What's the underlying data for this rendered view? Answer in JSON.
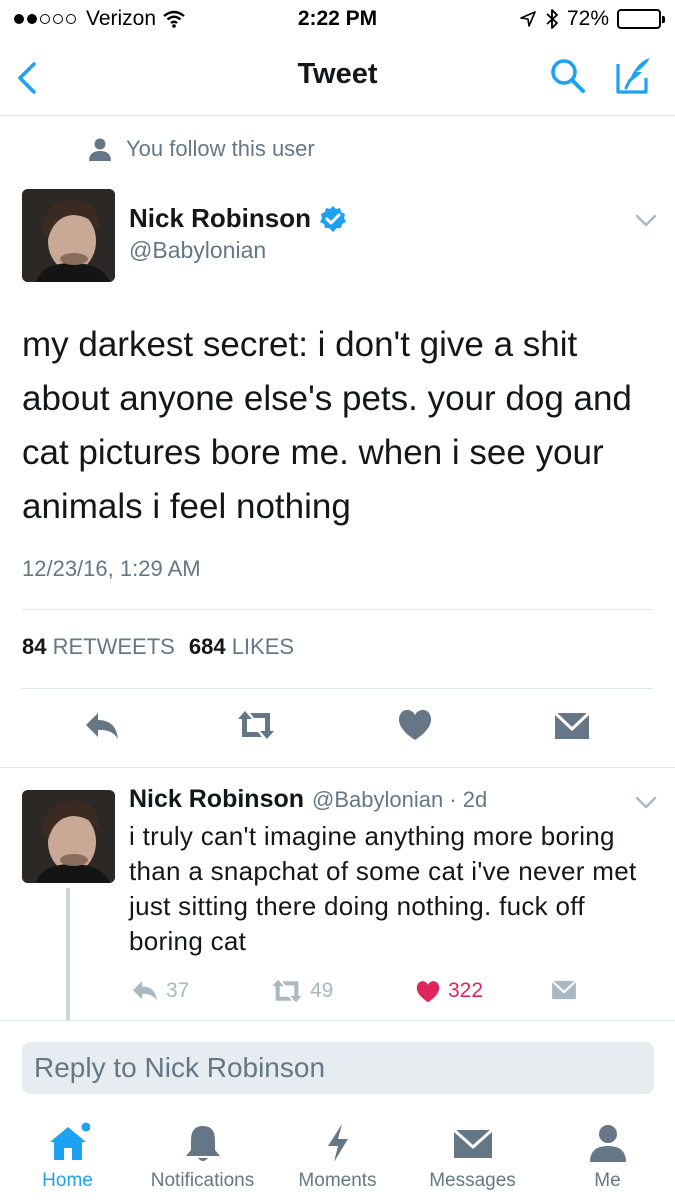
{
  "status_bar": {
    "carrier": "Verizon",
    "time": "2:22 PM",
    "battery": "72%",
    "battery_level": 0.72
  },
  "nav": {
    "title": "Tweet"
  },
  "follow_note": "You follow this user",
  "main_tweet": {
    "author_name": "Nick Robinson",
    "handle": "@Babylonian",
    "verified": true,
    "text": "my darkest secret: i don't give a shit about anyone else's pets. your dog and cat pictures bore me. when i see your animals i feel nothing",
    "timestamp": "12/23/16, 1:29 AM",
    "retweets_count": "84",
    "retweets_label": "RETWEETS",
    "likes_count": "684",
    "likes_label": "LIKES"
  },
  "reply_tweet": {
    "author_name": "Nick Robinson",
    "handle_time": "@Babylonian · 2d",
    "text": "i truly can't imagine anything more boring than a snapchat of some cat i've never met just sitting there doing nothing. fuck off boring cat",
    "replies": "37",
    "retweets": "49",
    "likes": "322"
  },
  "reply_box": {
    "placeholder": "Reply to Nick Robinson"
  },
  "tab_bar": [
    {
      "label": "Home",
      "icon": "home-icon",
      "active": true
    },
    {
      "label": "Notifications",
      "icon": "bell-icon",
      "active": false
    },
    {
      "label": "Moments",
      "icon": "lightning-icon",
      "active": false
    },
    {
      "label": "Messages",
      "icon": "envelope-icon",
      "active": false
    },
    {
      "label": "Me",
      "icon": "person-icon",
      "active": false
    }
  ],
  "colors": {
    "accent": "#1da1f2",
    "secondary_text": "#657786",
    "like": "#e0245e",
    "action_gray": "#657786"
  }
}
